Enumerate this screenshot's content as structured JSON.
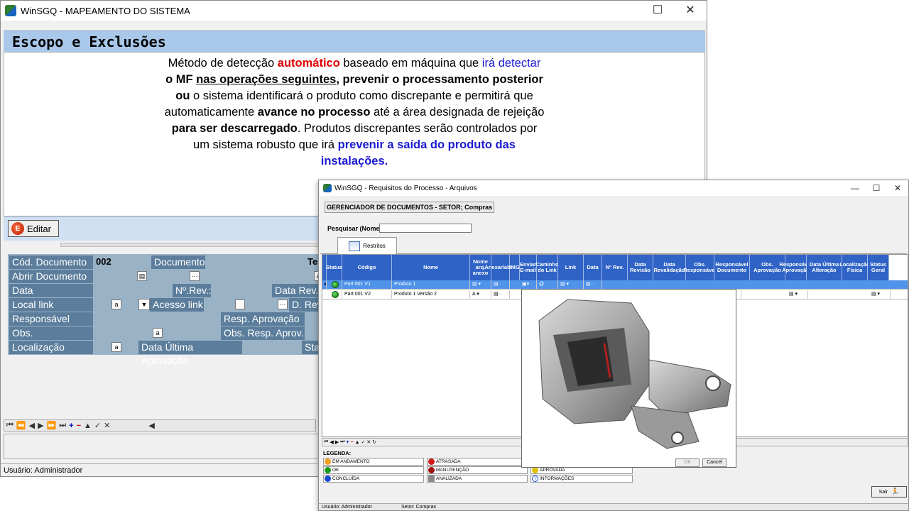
{
  "win1": {
    "title": "WinSGQ - MAPEAMENTO DO SISTEMA",
    "section_title": "Escopo e Exclusões",
    "text": {
      "l1a": "Método de detecção ",
      "l1b": "automático",
      "l1c": " baseado em máquina que ",
      "l1d": "irá detectar",
      "l2a": "o MF ",
      "l2b": "nas operações seguintes",
      "l2c": ", prevenir o processamento posterior",
      "l3a": "ou",
      "l3b": " o sistema identificará o produto como discrepante e permitirá que",
      "l4a": "automaticamente ",
      "l4b": "avance no processo",
      "l4c": " até a área designada de rejeição",
      "l5a": "para ser descarregado",
      "l5b": ". Produtos discrepantes serão controlados por",
      "l6a": "um sistema robusto que irá ",
      "l6b": "prevenir a saída do produto das",
      "l7": "instalações."
    },
    "edit_button": "Editar",
    "form": {
      "cod_doc_label": "Cód. Documento",
      "cod_doc_value": "002",
      "documento_label": "Documento",
      "documento_value": "Tes",
      "abrir_label": "Abrir Documento",
      "data_label": "Data",
      "nrev_label": "Nº.Rev.:",
      "datarev_label": "Data Rev.:",
      "local_label": "Local link",
      "acesso_label": "Acesso link",
      "drev_label": "D. Rev",
      "resp_label": "Responsável",
      "resp_aprov_label": "Resp. Aprovação",
      "obs_resp_label": "Obs. Responsável",
      "obs_resp_aprov_label": "Obs. Resp. Aprov.",
      "local2_label": "Localização",
      "data_ult_label": "Data Última Aprovação",
      "sta_label": "Sta"
    },
    "status": "Usuário: Administrador"
  },
  "win2": {
    "title": "WinSGQ - Requisitos do Processo - Arquivos",
    "gerenciador": "GERENCIADOR DE DOCUMENTOS - SETOR; Compras",
    "search_label": "Pesquisar (Nome):",
    "tab": "Restritos",
    "columns": [
      "Status",
      "Código",
      "Nome",
      "Nome arq. anexo",
      "Anexar/abrir",
      "IMG",
      "Enviar E-mail",
      "Caminho do Link",
      "Link",
      "Data",
      "Nº Rev.",
      "Data Revisão",
      "Data Revalidação",
      "Obs. Responsável",
      "Responsável Documento",
      "Obs. Aprovação",
      "Responsável Aprovação",
      "Data Última Alteração",
      "Localização Física",
      "Status Geral"
    ],
    "rows": [
      {
        "codigo": "Part 001 V1",
        "nome": "Produto 1"
      },
      {
        "codigo": "Part 001 V2",
        "nome": "Produto 1 Versão 2"
      }
    ],
    "popup": {
      "ok": "OK",
      "cancel": "Cancel"
    },
    "legend_title": "LEGENDA:",
    "legend": {
      "em_andamento": "EM ANDAMENTO",
      "ok": "OK",
      "concluida": "CONCLUÍDA",
      "atrasada": "ATRASADA",
      "manutencao": "MANUTENÇÃO",
      "analizada": "ANALIZADA",
      "aprovada": "APROVADA",
      "informacoes": "INFORMAÇÕES"
    },
    "sair": "Sair",
    "status_user": "Usuário: Administrador",
    "status_setor": "Setor: Compras"
  },
  "colors": {
    "accent": "#2f63c6",
    "header_bar": "#a9c8ea",
    "form_bg": "#9ab2c6",
    "label_bg": "#5c7e9c",
    "selected_row": "#4f93ea"
  }
}
